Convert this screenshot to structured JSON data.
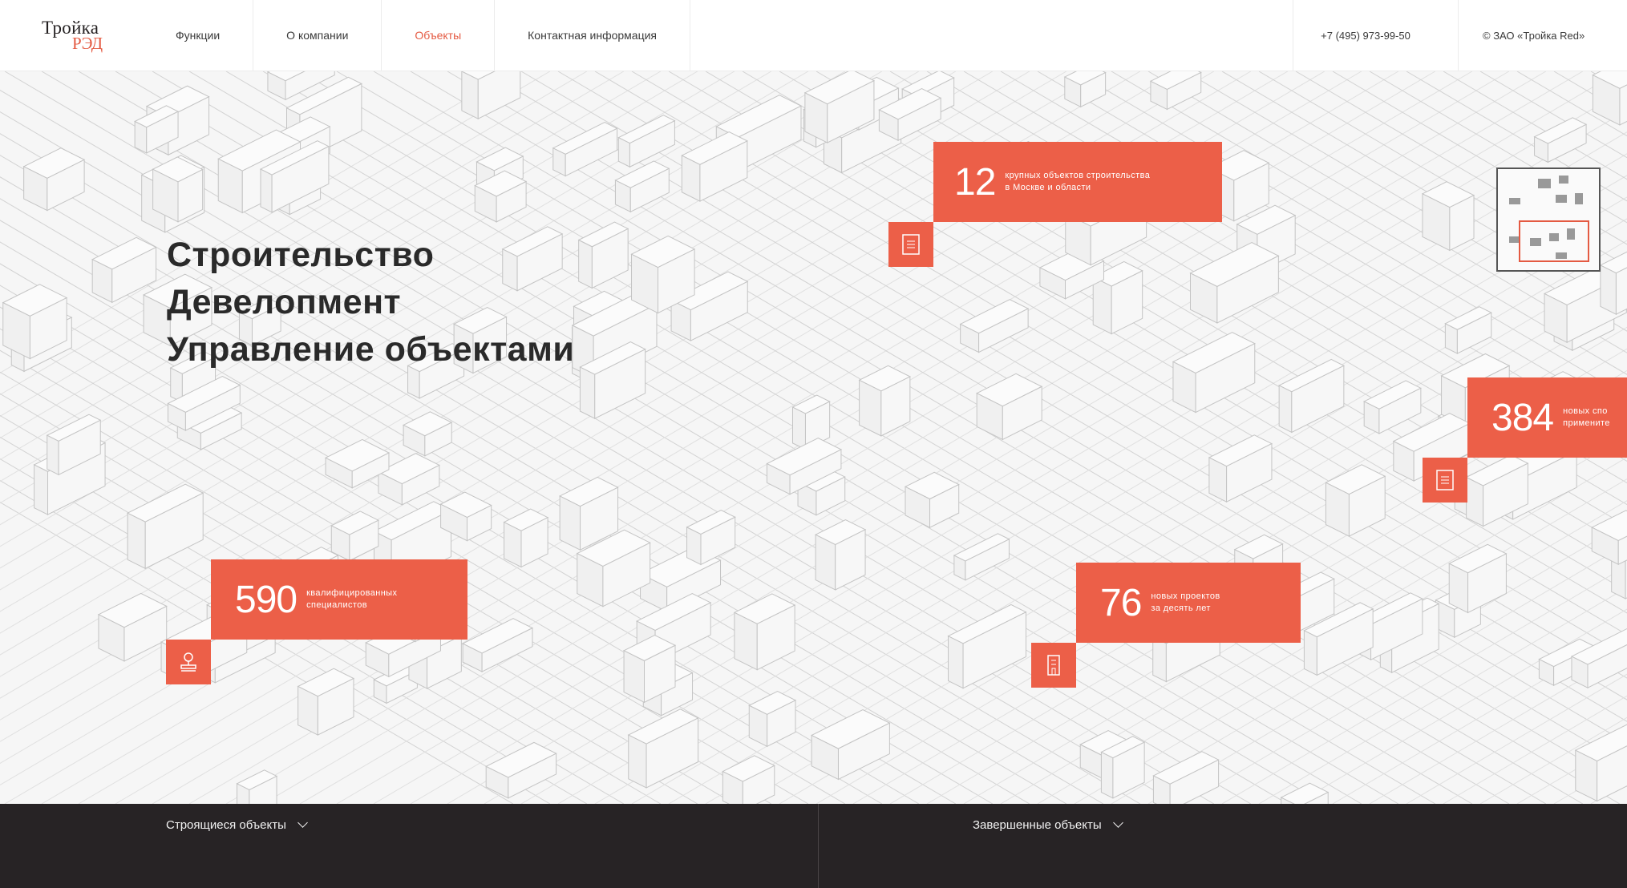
{
  "header": {
    "logo_line1": "Тройка",
    "logo_line2": "РЭД",
    "nav": [
      {
        "label": "Функции"
      },
      {
        "label": "О компании"
      },
      {
        "label": "Объекты"
      },
      {
        "label": "Контактная информация"
      }
    ],
    "phone": "+7 (495) 973-99-50",
    "copyright": "© ЗАО «Тройка Red»"
  },
  "hero": {
    "headline": [
      "Строительство",
      "Девелопмент",
      "Управление объектами"
    ],
    "stats": [
      {
        "number": "12",
        "line1": "крупных объектов строительства",
        "line2": "в Москве и области",
        "icon": "document-icon"
      },
      {
        "number": "384",
        "line1": "новых спо",
        "line2": "примените",
        "icon": "document-icon"
      },
      {
        "number": "590",
        "line1": "квалифицированных",
        "line2": "специалистов",
        "icon": "stamp-icon"
      },
      {
        "number": "76",
        "line1": "новых проектов",
        "line2": "за десять лет",
        "icon": "building-icon"
      }
    ]
  },
  "bottom": {
    "left_tab": "Строящиеся объекты",
    "right_tab": "Завершенные объекты"
  },
  "colors": {
    "accent": "#ec5f48",
    "dark": "#272325"
  }
}
